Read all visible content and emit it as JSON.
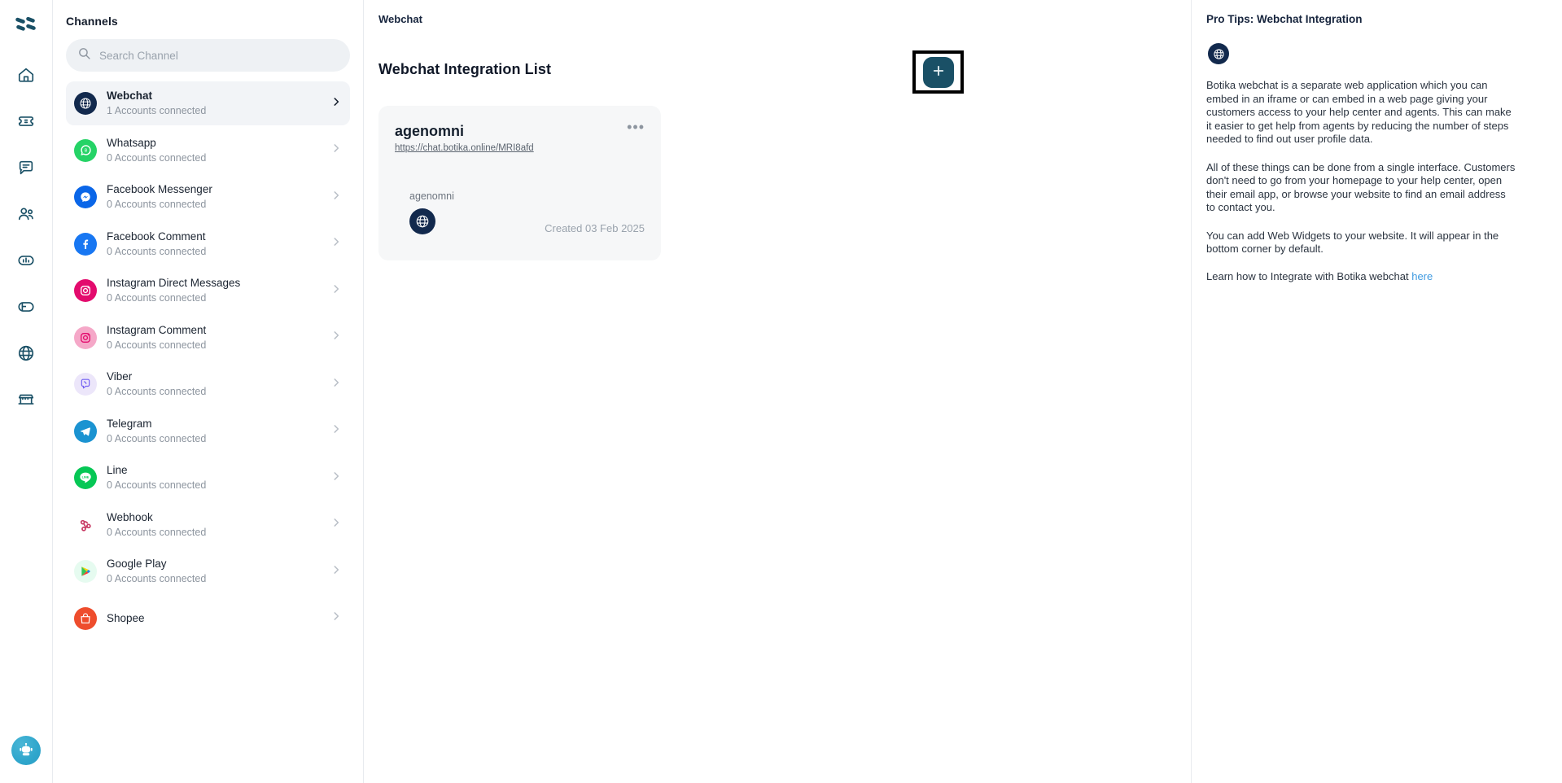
{
  "rail": {
    "logo": "botika-logo",
    "items": [
      {
        "name": "home-icon",
        "label": "Home"
      },
      {
        "name": "ticket-icon",
        "label": "Tickets"
      },
      {
        "name": "chat-icon",
        "label": "Chat"
      },
      {
        "name": "contacts-icon",
        "label": "Contacts"
      },
      {
        "name": "analytics-icon",
        "label": "Analytics"
      },
      {
        "name": "campaign-icon",
        "label": "Campaign"
      },
      {
        "name": "channels-icon",
        "label": "Channels"
      },
      {
        "name": "store-icon",
        "label": "Store"
      }
    ],
    "avatar": "robot-avatar"
  },
  "channels": {
    "title": "Channels",
    "search": {
      "value": "",
      "placeholder": "Search Channel"
    },
    "items": [
      {
        "name": "Webchat",
        "sub": "1 Accounts connected",
        "icon": "globe-icon",
        "active": true
      },
      {
        "name": "Whatsapp",
        "sub": "0 Accounts connected",
        "icon": "whatsapp-icon",
        "active": false
      },
      {
        "name": "Facebook Messenger",
        "sub": "0 Accounts connected",
        "icon": "messenger-icon",
        "active": false
      },
      {
        "name": "Facebook Comment",
        "sub": "0 Accounts connected",
        "icon": "facebook-icon",
        "active": false
      },
      {
        "name": "Instagram Direct Messages",
        "sub": "0 Accounts connected",
        "icon": "instagram-icon",
        "active": false
      },
      {
        "name": "Instagram Comment",
        "sub": "0 Accounts connected",
        "icon": "instagram-light-icon",
        "active": false
      },
      {
        "name": "Viber",
        "sub": "0 Accounts connected",
        "icon": "viber-icon",
        "active": false
      },
      {
        "name": "Telegram",
        "sub": "0 Accounts connected",
        "icon": "telegram-icon",
        "active": false
      },
      {
        "name": "Line",
        "sub": "0 Accounts connected",
        "icon": "line-icon",
        "active": false
      },
      {
        "name": "Webhook",
        "sub": "0 Accounts connected",
        "icon": "webhook-icon",
        "active": false
      },
      {
        "name": "Google Play",
        "sub": "0 Accounts connected",
        "icon": "google-play-icon",
        "active": false
      },
      {
        "name": "Shopee",
        "sub": "",
        "icon": "shopee-icon",
        "active": false
      }
    ]
  },
  "main": {
    "breadcrumb": "Webchat",
    "title": "Webchat Integration List",
    "add_button_label": "+",
    "cards": [
      {
        "title": "agenomni",
        "url": "https://chat.botika.online/MRI8afd",
        "account": "agenomni",
        "created": "Created 03 Feb 2025",
        "menu": "•••"
      }
    ]
  },
  "tips": {
    "title": "Pro Tips: Webchat Integration",
    "icon": "globe-icon",
    "paragraphs": [
      "Botika webchat is a separate web application which you can embed in an iframe or can embed in a web page giving your customers access to your help center and agents. This can make it easier to get help from agents by reducing the number of steps needed to find out user profile data.",
      "All of these things can be done from a single interface. Customers don't need to go from your homepage to your help center, open their email app, or browse your website to find an email address to contact you.",
      "You can add Web Widgets to your website. It will appear in the bottom corner by default."
    ],
    "learn_prefix": "Learn how to Integrate with Botika webchat ",
    "learn_link": "here"
  },
  "colors": {
    "accent_teal": "#1a5066",
    "navy": "#12294d",
    "link_blue": "#3f9ae0",
    "panel_grey": "#f6f7f8",
    "search_grey": "#eef1f4"
  }
}
